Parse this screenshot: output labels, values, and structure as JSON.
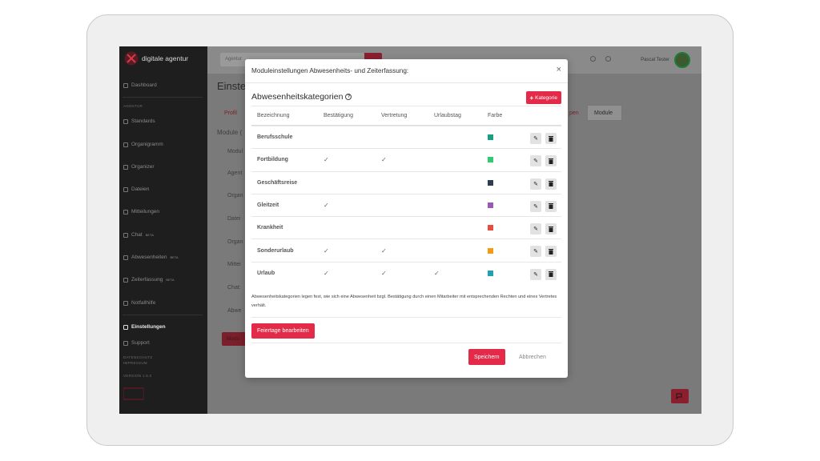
{
  "sidebar": {
    "logo_title": "digitale agentur",
    "logo_sub": "",
    "items": [
      {
        "label": "Dashboard",
        "beta": ""
      },
      {
        "label": "Standards",
        "beta": ""
      },
      {
        "label": "Organigramm",
        "beta": ""
      },
      {
        "label": "Organizer",
        "beta": ""
      },
      {
        "label": "Dateien",
        "beta": ""
      },
      {
        "label": "Mitteilungen",
        "beta": ""
      },
      {
        "label": "Chat",
        "beta": "BETA"
      },
      {
        "label": "Abwesenheiten",
        "beta": "BETA"
      },
      {
        "label": "Zeiterfassung",
        "beta": "BETA"
      },
      {
        "label": "Notfallhilfe",
        "beta": ""
      },
      {
        "label": "Einstellungen",
        "beta": ""
      },
      {
        "label": "Support",
        "beta": ""
      }
    ],
    "section_caption": "AGENTUR",
    "footer_links": [
      "DATENSCHUTZ",
      "IMPRESSUM"
    ],
    "version": "VERSION 1.5.0"
  },
  "topbar": {
    "search_placeholder": "Agentur",
    "user_name": "Pascal Tester"
  },
  "background": {
    "page_title": "Einstel",
    "tab_profil": "Profil",
    "tab_gruppen": "pen",
    "tab_module": "Module",
    "section": "Module (",
    "rows": [
      "Modul",
      "Agent",
      "Organ",
      "Datei",
      "Organ",
      "Mittei",
      "Chat:",
      "Abwe"
    ],
    "button": "Modu"
  },
  "modal": {
    "title": "Moduleinstellungen Abwesenheits- und Zeiterfassung:",
    "close": "×",
    "section_title": "Abwesenheitskategorien",
    "add_button": "Kategorie",
    "columns": [
      "Bezeichnung",
      "Bestätigung",
      "Vertretung",
      "Urlaubstag",
      "Farbe"
    ],
    "rows": [
      {
        "name": "Berufsschule",
        "bestaetigung": false,
        "vertretung": false,
        "urlaubstag": false,
        "color": "#16a085"
      },
      {
        "name": "Fortbildung",
        "bestaetigung": true,
        "vertretung": true,
        "urlaubstag": false,
        "color": "#2ecc71"
      },
      {
        "name": "Geschäftsreise",
        "bestaetigung": false,
        "vertretung": false,
        "urlaubstag": false,
        "color": "#2c3e50"
      },
      {
        "name": "Gleitzeit",
        "bestaetigung": true,
        "vertretung": false,
        "urlaubstag": false,
        "color": "#9b59b6"
      },
      {
        "name": "Krankheit",
        "bestaetigung": false,
        "vertretung": false,
        "urlaubstag": false,
        "color": "#e74c3c"
      },
      {
        "name": "Sonderurlaub",
        "bestaetigung": true,
        "vertretung": true,
        "urlaubstag": false,
        "color": "#f39c12"
      },
      {
        "name": "Urlaub",
        "bestaetigung": true,
        "vertretung": true,
        "urlaubstag": true,
        "color": "#1fa0b5"
      }
    ],
    "note": "Abwesenheitskategorien legen fest, wie sich eine Abwesenheit bzgl. Bestätigung durch einen Mitarbeiter mit entsprechenden Rechten und eines Vertretes verhält.",
    "holiday_button": "Feiertage bearbeiten",
    "save_button": "Speichern",
    "cancel_button": "Abbrechen"
  },
  "colors": {
    "accent": "#e32b49",
    "sidebar": "#1e1e1e"
  }
}
